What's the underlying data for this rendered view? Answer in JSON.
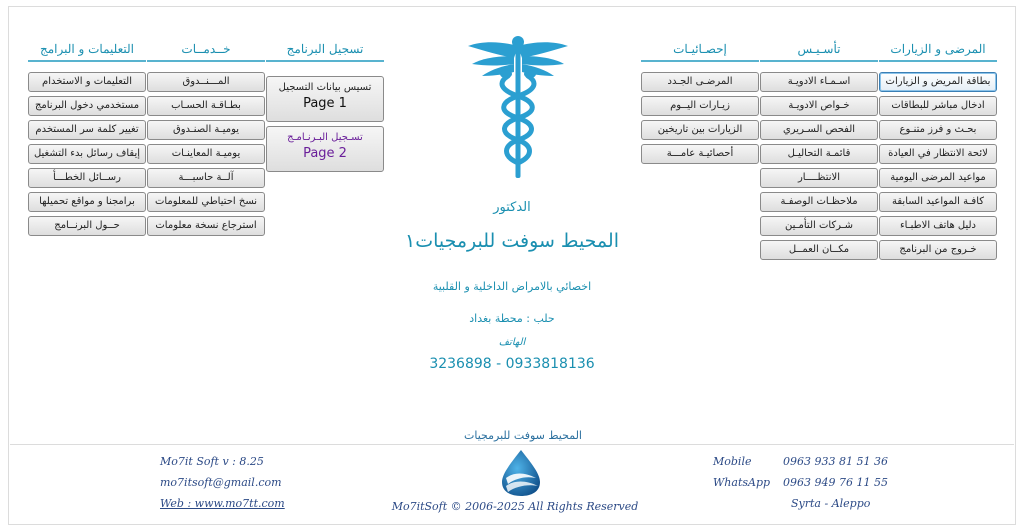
{
  "columns": {
    "instructions": {
      "header": "التعليمات و البرامج",
      "items": [
        "التعليمات و الاستخدام",
        "مستخدمي دخول البرنامج",
        "تغيير كلمة سر المستخدم",
        "إيقاف رسائل بدء التشغيل",
        "رســائل الخطـــأ",
        "برامجنا و مواقع تحميلها",
        "حــول البرنــامج"
      ]
    },
    "services": {
      "header": "خــدمــات",
      "items": [
        "المـــنــدوق",
        "بطـاقـة الحسـاب",
        "يوميـة الصنـدوق",
        "يوميـة المعاينـات",
        "آلــة حاسبـــة",
        "نسخ احتياطي للمعلومات",
        "استرجاع نسخة معلومات"
      ]
    },
    "registration": {
      "header": "تسجيل البرنامج",
      "items": [
        {
          "label": "تسيس بيانات التسجيل",
          "page": "Page 1"
        },
        {
          "label": "تسـجيل البـرنـامـج",
          "page": "Page 2"
        }
      ]
    },
    "statistics": {
      "header": "إحصـائيـات",
      "items": [
        "المرضـى الجـدد",
        "زيـارات اليــوم",
        "الزيارات بين تاريخين",
        "أحصائيـة عامـــة"
      ]
    },
    "setup": {
      "header": "تأسـيـس",
      "items": [
        "اسـمـاء الادويـة",
        "خـواص الادويـة",
        "الفحص السـريري",
        "قائمـة التحاليـل",
        "الانتظــــار",
        "ملاحظـات الوصفـة",
        "شـركات التأمـين",
        "مكــان العمــل"
      ]
    },
    "patients": {
      "header": "المرضى و الزيارات",
      "items": [
        "بطاقة المريض و الزيارات",
        "ادخال مباشر للبطاقات",
        "بحـث و فرز متنـوع",
        "لائحة الانتظار في العيادة",
        "مواعيد المرضى اليومية",
        "كافـة المواعيد السابقة",
        "دليل هاتف الاطبـاء",
        "خـروج من البرنامج"
      ]
    }
  },
  "center": {
    "doctor_label": "الدكتور",
    "company_name": "المحيط سوفت للبرمجيات١",
    "specialty": "اخصائي بالامراض الداخلية و القلبية",
    "address": "حلب : محطة بغداد",
    "phone_label": "الهاتف",
    "phones": "3236898 - 0933818136"
  },
  "footer": {
    "title": "المحيط سوفت للبرمجيات",
    "left": {
      "version": "Mo7it Soft    v : 8.25",
      "email": "mo7itsoft@gmail.com",
      "web": "Web : www.mo7tt.com"
    },
    "right": {
      "mobile_label": "Mobile",
      "mobile": "0963 933 81 51 36",
      "whatsapp_label": "WhatsApp",
      "whatsapp": "0963 949 76 11 55",
      "city": "Syrta   -  Aleppo"
    },
    "copyright": "Mo7itSoft © 2006-2025 All Rights Reserved"
  },
  "colors": {
    "accent": "#1a8fb0",
    "line": "#58b3cf",
    "footer_text": "#2c4a86",
    "purple": "#6a1f9a"
  },
  "icons": {
    "main_logo": "caduceus-icon",
    "footer_logo": "wave-drop-icon"
  }
}
